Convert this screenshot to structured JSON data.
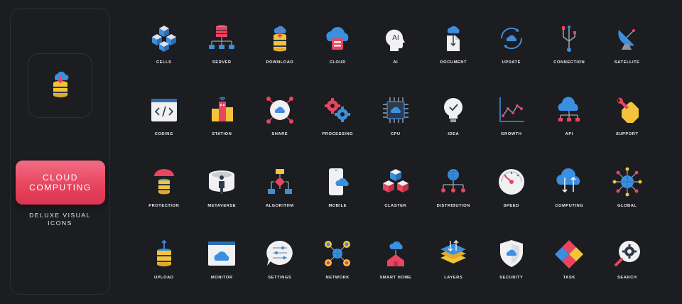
{
  "title": {
    "line1": "CLOUD",
    "line2": "COMPUTING"
  },
  "subtitle": {
    "line1": "DELUXE VISUAL",
    "line2": "ICONS"
  },
  "colors": {
    "background": "#1c1d21",
    "accent_red": "#e8455f",
    "blue": "#3b8fe0",
    "yellow": "#f3c33a",
    "white": "#f1f1f3",
    "dark": "#2d3a4a"
  },
  "icons": [
    {
      "label": "CELLS",
      "icon": "cells-icon"
    },
    {
      "label": "SERVER",
      "icon": "server-icon"
    },
    {
      "label": "DOWNLOAD",
      "icon": "download-icon"
    },
    {
      "label": "CLOUD",
      "icon": "cloud-icon"
    },
    {
      "label": "AI",
      "icon": "ai-icon"
    },
    {
      "label": "DOCUMENT",
      "icon": "document-icon"
    },
    {
      "label": "UPDATE",
      "icon": "update-icon"
    },
    {
      "label": "CONNECTION",
      "icon": "connection-icon"
    },
    {
      "label": "SATELLITE",
      "icon": "satellite-icon"
    },
    {
      "label": "CODING",
      "icon": "coding-icon"
    },
    {
      "label": "STATION",
      "icon": "station-icon"
    },
    {
      "label": "SHARE",
      "icon": "share-icon"
    },
    {
      "label": "PROCESSING",
      "icon": "processing-icon"
    },
    {
      "label": "CPU",
      "icon": "cpu-icon"
    },
    {
      "label": "IDEA",
      "icon": "idea-icon"
    },
    {
      "label": "GROWTH",
      "icon": "growth-icon"
    },
    {
      "label": "API",
      "icon": "api-icon"
    },
    {
      "label": "SUPPORT",
      "icon": "support-icon"
    },
    {
      "label": "PROTECTION",
      "icon": "protection-icon"
    },
    {
      "label": "METAVERSE",
      "icon": "metaverse-icon"
    },
    {
      "label": "ALGORITHM",
      "icon": "algorithm-icon"
    },
    {
      "label": "MOBILE",
      "icon": "mobile-icon"
    },
    {
      "label": "CLASTER",
      "icon": "claster-icon"
    },
    {
      "label": "DISTRIBUTION",
      "icon": "distribution-icon"
    },
    {
      "label": "SPEED",
      "icon": "speed-icon"
    },
    {
      "label": "COMPUTING",
      "icon": "computing-icon"
    },
    {
      "label": "GLOBAL",
      "icon": "global-icon"
    },
    {
      "label": "UPLOAD",
      "icon": "upload-icon"
    },
    {
      "label": "MONITOR",
      "icon": "monitor-icon"
    },
    {
      "label": "SETTINGS",
      "icon": "settings-icon"
    },
    {
      "label": "NETWORK",
      "icon": "network-icon"
    },
    {
      "label": "SMART HOME",
      "icon": "smart-home-icon"
    },
    {
      "label": "LAYERS",
      "icon": "layers-icon"
    },
    {
      "label": "SECURITY",
      "icon": "security-icon"
    },
    {
      "label": "TASK",
      "icon": "task-icon"
    },
    {
      "label": "SEARCH",
      "icon": "search-icon"
    }
  ],
  "preview_icon": "cloud-database-icon",
  "ai_text": "AI"
}
